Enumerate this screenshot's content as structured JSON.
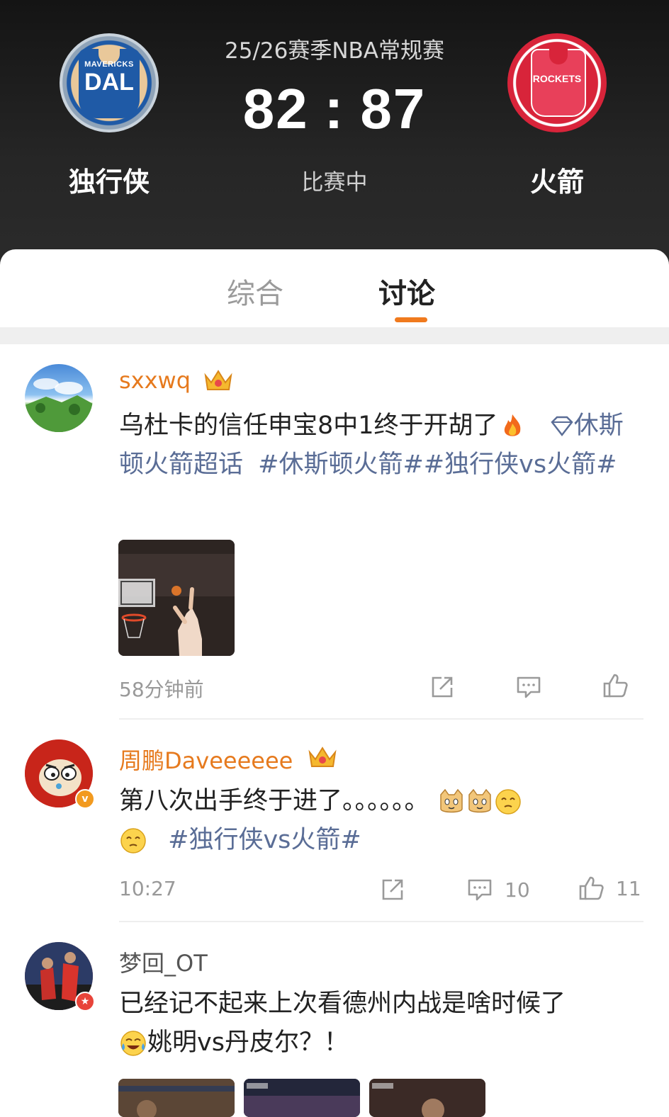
{
  "game": {
    "season_title": "25/26赛季NBA常规赛",
    "home_score": "82",
    "separator": ":",
    "away_score": "87",
    "status": "比赛中",
    "home_team": {
      "name": "独行侠",
      "logo_text_small": "MAVERICKS",
      "logo_text_big": "DAL",
      "logo_color": "#1f5aa6"
    },
    "away_team": {
      "name": "火箭",
      "logo_text": "ROCKETS",
      "logo_color": "#d8243a"
    }
  },
  "tabs": [
    {
      "label": "综合",
      "active": false
    },
    {
      "label": "讨论",
      "active": true
    }
  ],
  "accent_color": "#f07a1e",
  "posts": [
    {
      "username": "sxxwq",
      "username_style": "vip",
      "text": "乌杜卡的信任申宝8中1终于开胡了",
      "emoji": "fire-emoji",
      "super_topic": "休斯顿火箭超话",
      "topics": "#休斯顿火箭##独行侠vs火箭#",
      "time": "58分钟前",
      "comments": "",
      "likes": ""
    },
    {
      "username": "周鹏Daveeeeee",
      "username_style": "vip",
      "text": "第八次出手终于进了。。。。。。",
      "emoji": "cat-face-emoji",
      "topics": "#独行侠vs火箭#",
      "time": "10:27",
      "comments": "10",
      "likes": "11"
    },
    {
      "username": "梦回_OT",
      "username_style": "plain",
      "text_line1": "已经记不起来上次看德州内战是啥时候了",
      "text_line2": "姚明vs丹皮尔？！",
      "emoji": "laughing-tears-emoji"
    }
  ]
}
